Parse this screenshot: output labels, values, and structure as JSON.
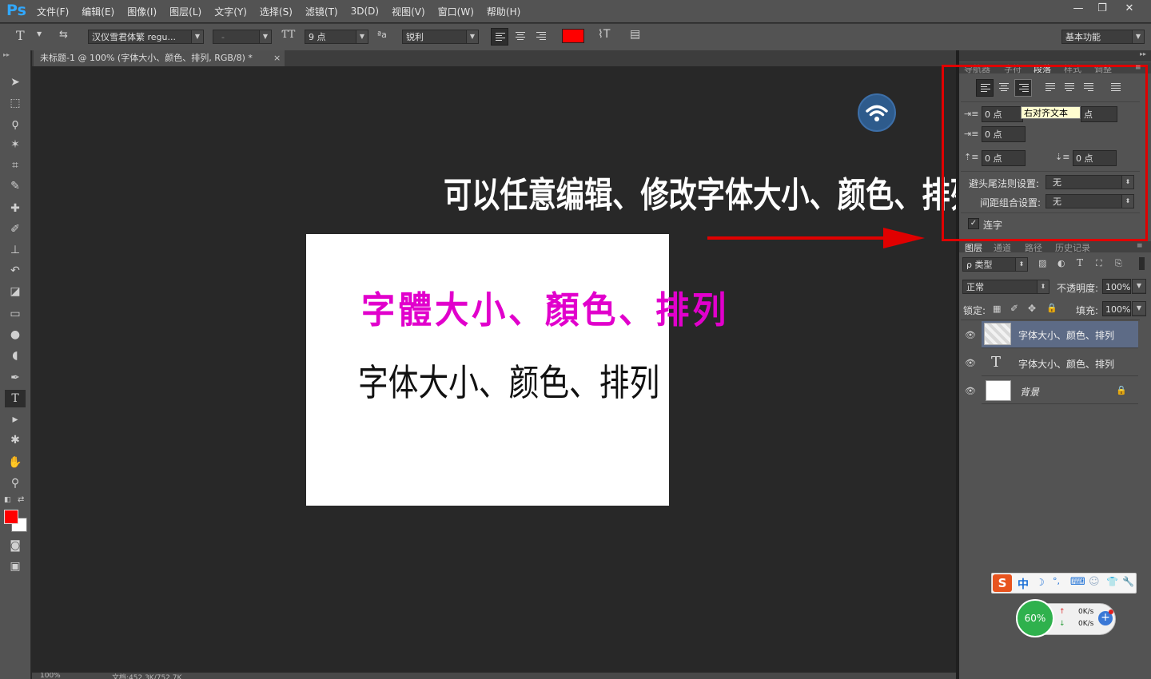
{
  "app": {
    "logo": "Ps"
  },
  "menu": [
    "文件(F)",
    "编辑(E)",
    "图像(I)",
    "图层(L)",
    "文字(Y)",
    "选择(S)",
    "滤镜(T)",
    "3D(D)",
    "视图(V)",
    "窗口(W)",
    "帮助(H)"
  ],
  "window_buttons": {
    "minimize": "—",
    "restore": "❐",
    "close": "✕"
  },
  "options": {
    "tool_glyph": "T",
    "font_family": "汉仪雪君体繁 regu...",
    "font_style": "-",
    "font_size": "9 点",
    "aa_label": "ªa",
    "antialias": "锐利",
    "text_color": "#ff0000",
    "workspace": "基本功能"
  },
  "document": {
    "tab_title": "未标题-1 @ 100% (字体大小、颜色、排列, RGB/8) *",
    "close_glyph": "×"
  },
  "canvas": {
    "line1": "字體大小、顏色、排列",
    "line1_color": "#e100cc",
    "line2": "字体大小、颜色、排列"
  },
  "annotation": {
    "text": "可以任意编辑、修改字体大小、颜色、排列等",
    "arrow_color": "#e00000"
  },
  "paragraph_panel": {
    "tabs": [
      "导航器",
      "字符",
      "段落",
      "样式",
      "调整"
    ],
    "active_tab": "段落",
    "left_indent": "0 点",
    "right_indent_unit": "点",
    "first_line_indent": "0 点",
    "space_before": "0 点",
    "space_after": "0 点",
    "kinsoku_label": "避头尾法则设置:",
    "kinsoku_value": "无",
    "mojikumi_label": "间距组合设置:",
    "mojikumi_value": "无",
    "hyphenate_label": "连字",
    "hyphenate_checked": true,
    "tooltip": "右对齐文本"
  },
  "layers_panel": {
    "tabs": [
      "图层",
      "通道",
      "路径",
      "历史记录"
    ],
    "filter_kind": "ρ 类型",
    "blend_mode": "正常",
    "opacity_label": "不透明度:",
    "opacity_value": "100%",
    "lock_label": "锁定:",
    "fill_label": "填充:",
    "fill_value": "100%",
    "layers": [
      {
        "name": "字体大小、颜色、排列",
        "selected": true
      },
      {
        "name": "字体大小、颜色、排列",
        "selected": false
      },
      {
        "name": "背景",
        "selected": false
      }
    ]
  },
  "status": {
    "zoom": "100%",
    "doc_size": "文档:452.3K/752.7K"
  },
  "ime_toolbar": {
    "logo": "S",
    "mode": "中",
    "items": [
      "☽",
      "°,",
      "⌨",
      "☺",
      "👕",
      "🔧"
    ]
  },
  "net_widget": {
    "percent": "60%",
    "up": "0K/s",
    "down": "0K/s",
    "plus": "+"
  }
}
